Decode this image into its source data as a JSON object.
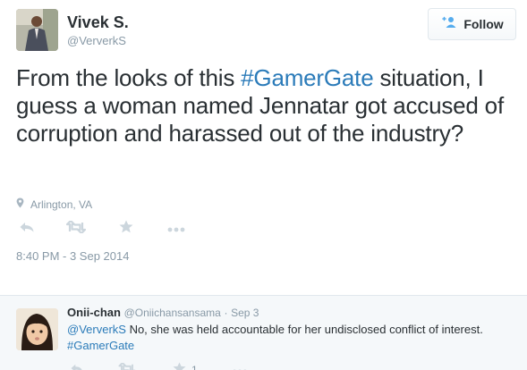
{
  "tweet": {
    "author_name": "Vivek S.",
    "author_handle": "@VerverkS",
    "follow_label": "Follow",
    "text_before": "From the looks of this ",
    "hashtag": "#GamerGate",
    "text_after": " situation, I guess a woman named Jennatar got accused of corruption and harassed out of the industry?",
    "location": "Arlington, VA",
    "timestamp": "8:40 PM - 3 Sep 2014",
    "icons": [
      "reply-icon",
      "retweet-icon",
      "favorite-icon",
      "more-icon",
      "location-pin-icon",
      "follow-person-plus-icon"
    ]
  },
  "reply": {
    "name": "Onii-chan",
    "handle": "@Oniichansansama",
    "separator": "·",
    "date": "Sep 3",
    "mention": "@VerverkS",
    "text": " No, she was held accountable for her undisclosed conflict of interest. ",
    "hashtag": "#GamerGate",
    "favorite_count": "1"
  },
  "colors": {
    "link": "#2b7bb9",
    "text": "#292f33",
    "muted": "#8899a6",
    "reply_bg": "#f5f8fa",
    "border": "#e1e8ed"
  }
}
